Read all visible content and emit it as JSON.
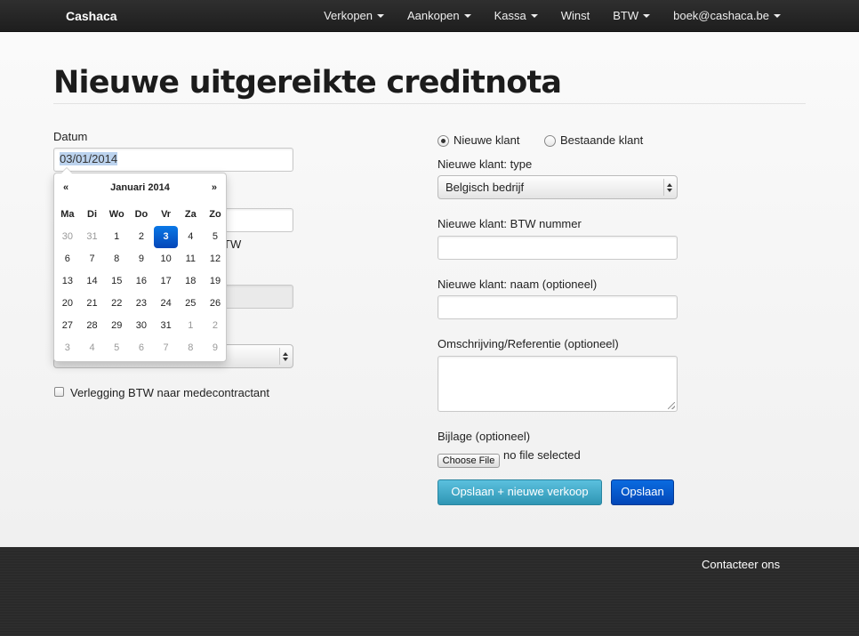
{
  "brand": "Cashaca",
  "nav": {
    "items": [
      {
        "label": "Verkopen",
        "dropdown": true
      },
      {
        "label": "Aankopen",
        "dropdown": true
      },
      {
        "label": "Kassa",
        "dropdown": true
      },
      {
        "label": "Winst",
        "dropdown": false
      },
      {
        "label": "BTW",
        "dropdown": true
      },
      {
        "label": "boek@cashaca.be",
        "dropdown": true
      }
    ]
  },
  "page": {
    "title": "Nieuwe uitgereikte creditnota"
  },
  "left": {
    "datum_label": "Datum",
    "datum_value": "03/01/2014",
    "partial_text": "TW",
    "checkbox_label": "Verlegging BTW naar medecontractant"
  },
  "datepicker": {
    "prev": "«",
    "next": "»",
    "title": "Januari 2014",
    "weekdays": [
      "Ma",
      "Di",
      "Wo",
      "Do",
      "Vr",
      "Za",
      "Zo"
    ],
    "weeks": [
      [
        "30",
        "31",
        "1",
        "2",
        "3",
        "4",
        "5"
      ],
      [
        "6",
        "7",
        "8",
        "9",
        "10",
        "11",
        "12"
      ],
      [
        "13",
        "14",
        "15",
        "16",
        "17",
        "18",
        "19"
      ],
      [
        "20",
        "21",
        "22",
        "23",
        "24",
        "25",
        "26"
      ],
      [
        "27",
        "28",
        "29",
        "30",
        "31",
        "1",
        "2"
      ],
      [
        "3",
        "4",
        "5",
        "6",
        "7",
        "8",
        "9"
      ]
    ],
    "selected": "3"
  },
  "right": {
    "radio_new": "Nieuwe klant",
    "radio_existing": "Bestaande klant",
    "type_label": "Nieuwe klant: type",
    "type_value": "Belgisch bedrijf",
    "btw_label": "Nieuwe klant: BTW nummer",
    "naam_label": "Nieuwe klant: naam (optioneel)",
    "omschrijving_label": "Omschrijving/Referentie (optioneel)",
    "bijlage_label": "Bijlage (optioneel)",
    "choose_file": "Choose File",
    "no_file": "no file selected",
    "btn_save_new": "Opslaan + nieuwe verkoop",
    "btn_save": "Opslaan"
  },
  "footer": {
    "contact": "Contacteer ons"
  },
  "colors": {
    "navbar": "#222222",
    "primary": "#0456c8",
    "info": "#49afcd",
    "footer": "#2a2a2a"
  }
}
